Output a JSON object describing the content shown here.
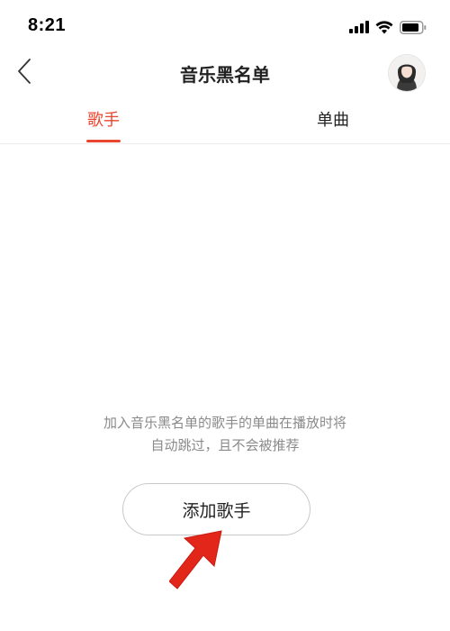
{
  "status_bar": {
    "time": "8:21"
  },
  "nav": {
    "title": "音乐黑名单"
  },
  "tabs": [
    {
      "label": "歌手",
      "active": true
    },
    {
      "label": "单曲",
      "active": false
    }
  ],
  "empty_state": {
    "line1": "加入音乐黑名单的歌手的单曲在播放时将",
    "line2": "自动跳过，且不会被推荐",
    "button_label": "添加歌手"
  },
  "colors": {
    "accent": "#e9462f",
    "arrow": "#e2261a",
    "muted_text": "#8a8a8a"
  },
  "icons": {
    "back": "chevron-left-icon",
    "signal": "signal-icon",
    "wifi": "wifi-icon",
    "battery": "battery-icon",
    "arrow": "pointer-arrow-icon"
  }
}
